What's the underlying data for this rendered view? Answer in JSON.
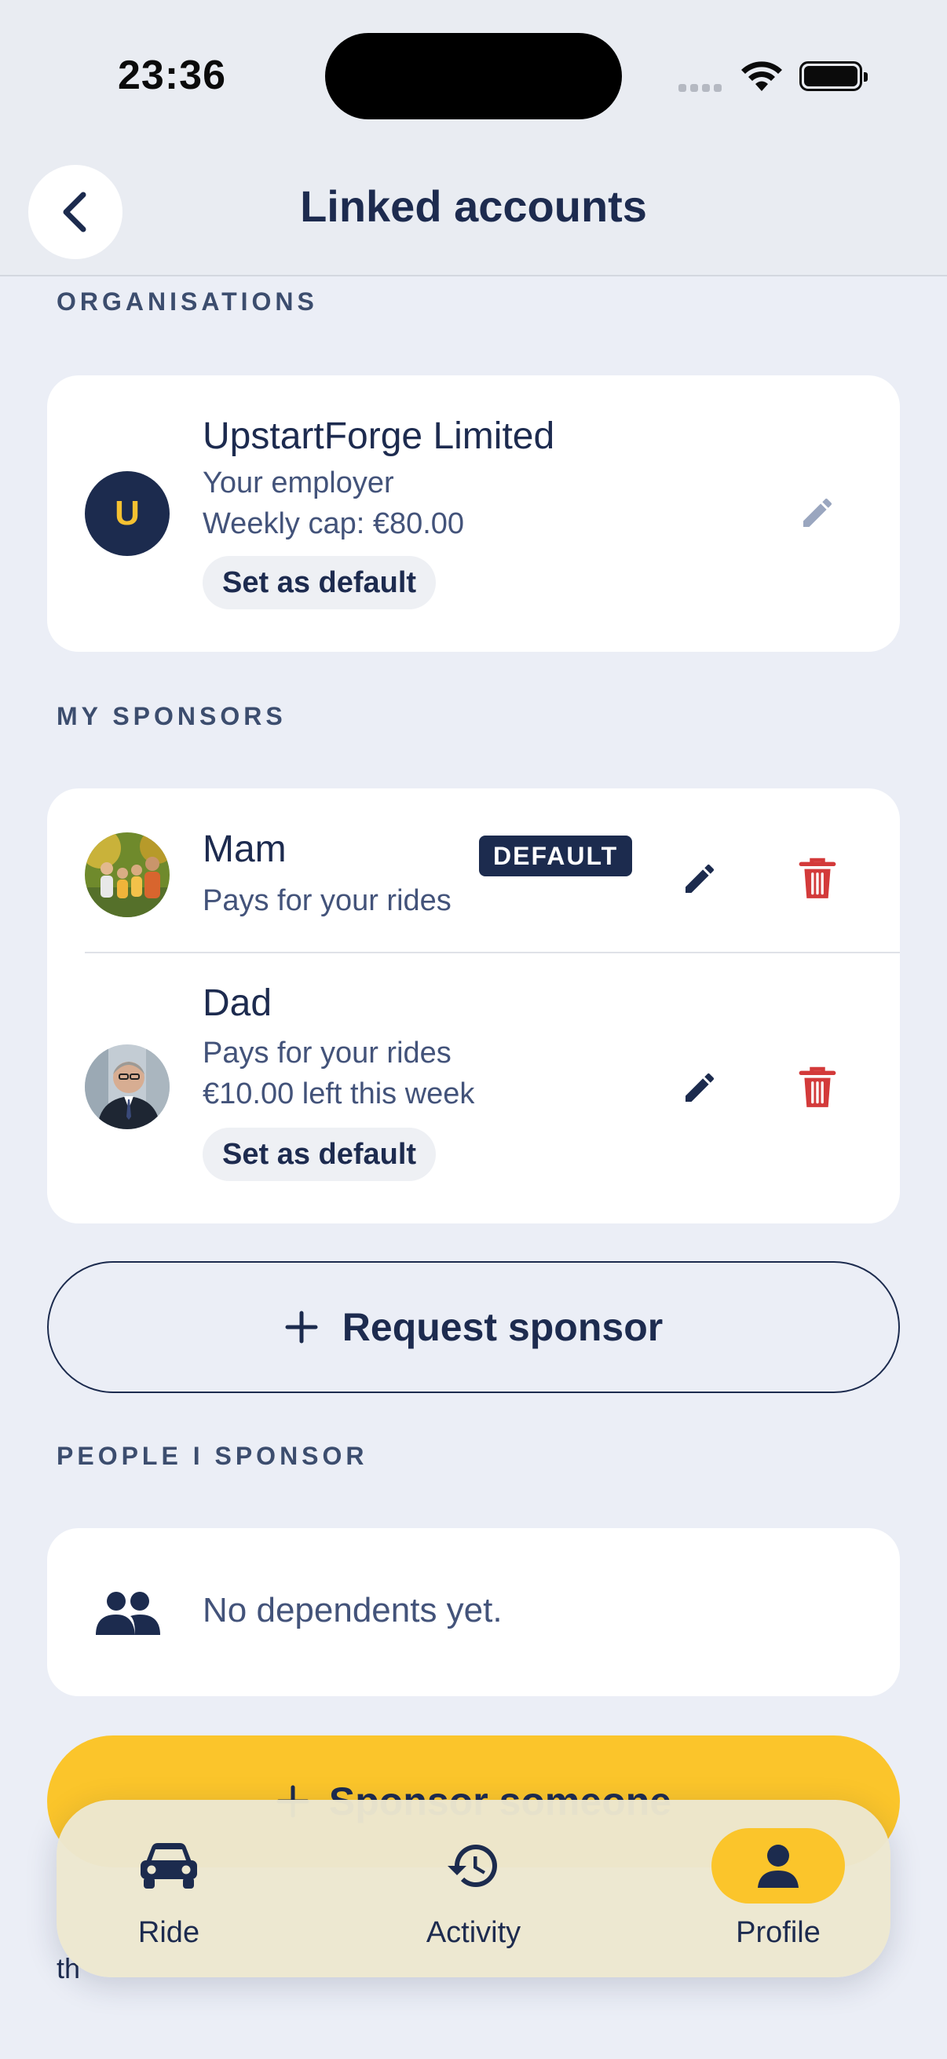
{
  "status_bar": {
    "time": "23:36"
  },
  "header": {
    "title": "Linked accounts"
  },
  "organisations": {
    "label": "ORGANISATIONS",
    "items": [
      {
        "initial": "U",
        "name": "UpstartForge Limited",
        "role": "Your employer",
        "cap": "Weekly cap: €80.00",
        "action": "Set as default"
      }
    ]
  },
  "sponsors": {
    "label": "MY SPONSORS",
    "items": [
      {
        "name": "Mam",
        "badge": "DEFAULT",
        "desc": "Pays for your rides"
      },
      {
        "name": "Dad",
        "desc": "Pays for your rides",
        "remaining": "€10.00 left this week",
        "action": "Set as default"
      }
    ],
    "request_button": "Request sponsor"
  },
  "dependents": {
    "label": "PEOPLE I SPONSOR",
    "empty_text": "No dependents yet.",
    "sponsor_button": "Sponsor someone",
    "footnote": "th"
  },
  "tab_bar": {
    "tabs": [
      {
        "label": "Ride",
        "icon": "car-icon"
      },
      {
        "label": "Activity",
        "icon": "history-icon"
      },
      {
        "label": "Profile",
        "icon": "person-icon",
        "active": true
      }
    ]
  },
  "colors": {
    "accent": "#fbc52b",
    "navy": "#1c2b4e",
    "danger": "#d33a3a",
    "background": "#ebeef6"
  }
}
